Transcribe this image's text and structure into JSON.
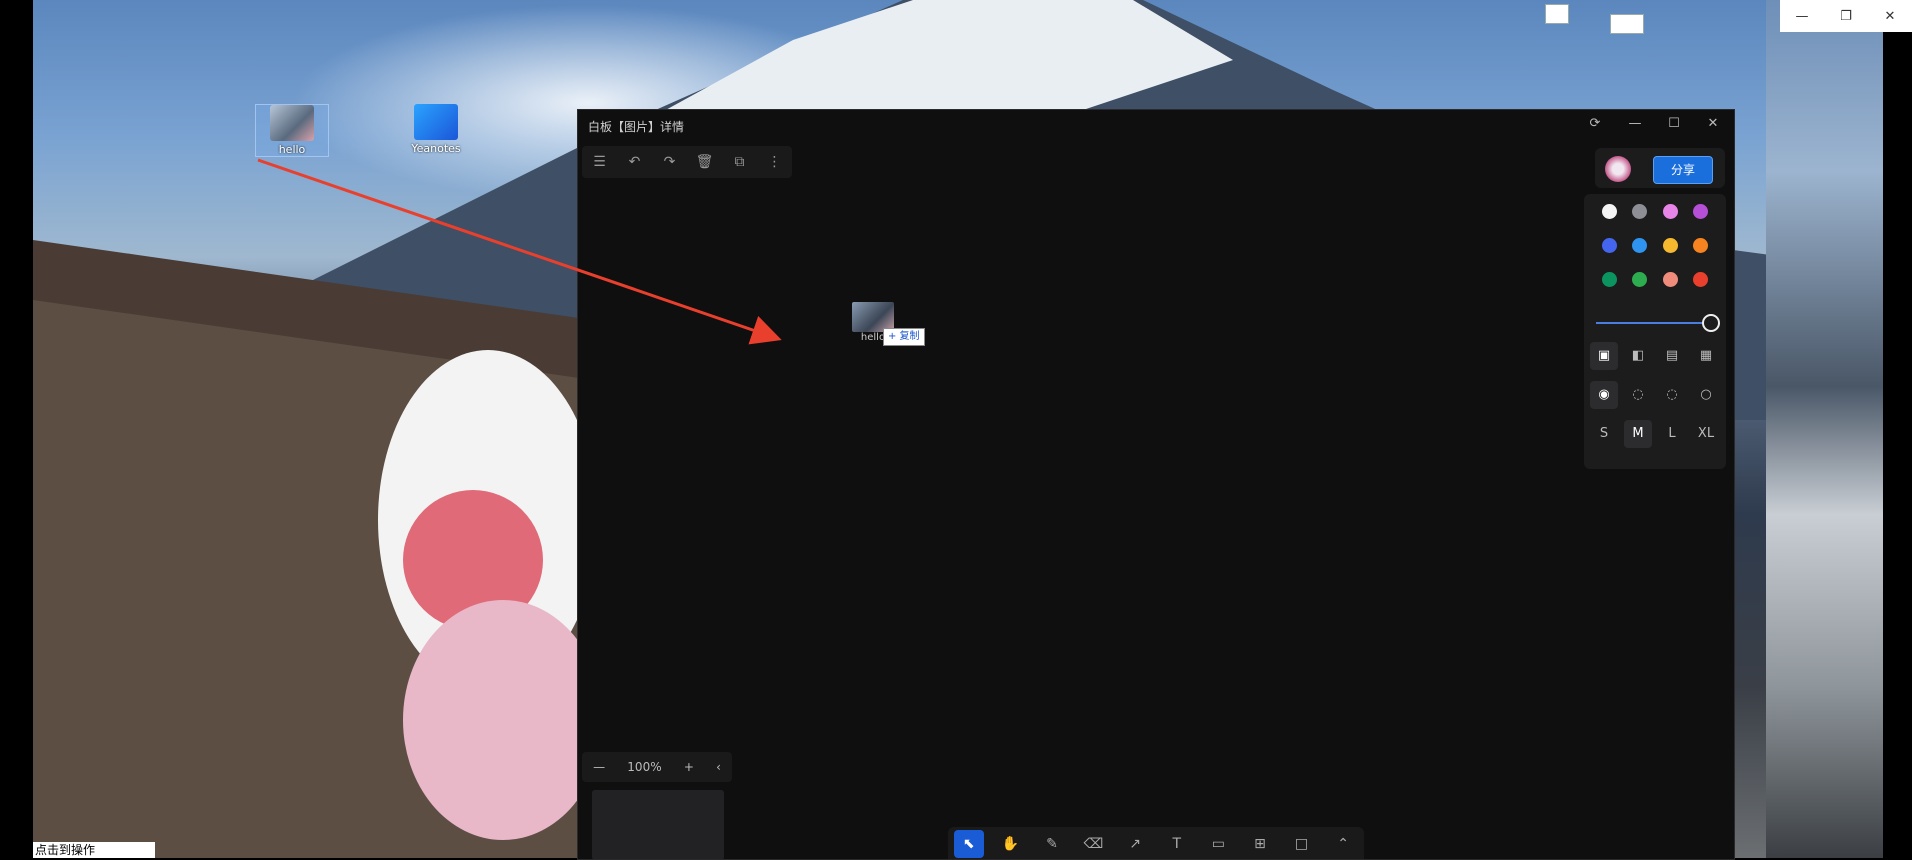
{
  "desktop": {
    "icons": [
      {
        "label": "hello"
      },
      {
        "label": "Yeanotes"
      }
    ],
    "bottom_text": "点击到操作"
  },
  "system_controls": {
    "minimize": "—",
    "restore": "❐",
    "close": "✕"
  },
  "window": {
    "title": "白板【图片】详情",
    "controls": {
      "refresh": "⟳",
      "minimize": "—",
      "maximize": "☐",
      "close": "✕"
    },
    "toolbar": {
      "menu": "☰",
      "undo": "↶",
      "redo": "↷",
      "delete": "🗑",
      "duplicate": "⧉",
      "more": "⋮"
    },
    "canvas_item": {
      "label": "hello",
      "copy_badge": "+ 复制"
    },
    "share_button": "分享",
    "colors": [
      "#f4f4f4",
      "#8e8e96",
      "#e784e8",
      "#b44fd6",
      "#4466ee",
      "#2f93f0",
      "#f5b92f",
      "#f5831f",
      "#0b9460",
      "#2dad4f",
      "#f08c7c",
      "#e8402d"
    ],
    "fill_icons": [
      "▣",
      "◧",
      "▤",
      "▦"
    ],
    "stroke_icons": [
      "◉",
      "◌",
      "◌",
      "○"
    ],
    "sizes": [
      "S",
      "M",
      "L",
      "XL"
    ],
    "zoom": {
      "out": "—",
      "level": "100%",
      "in": "+",
      "collapse": "‹"
    },
    "tools": {
      "select": "⬉",
      "hand": "✋",
      "pencil": "✎",
      "eraser": "⌫",
      "arrow": "↗",
      "text": "T",
      "note": "▭",
      "frame": "⊞",
      "rect": "□",
      "more": "⌃"
    }
  }
}
